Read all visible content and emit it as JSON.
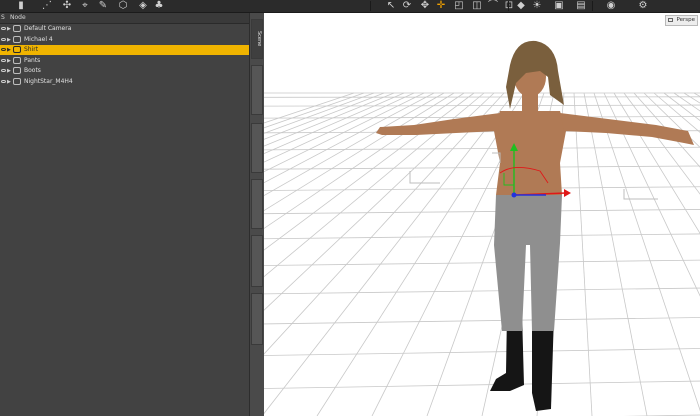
{
  "toolbar": {
    "icons": [
      "figure-icon",
      "wire-icon",
      "joint-icon",
      "node-icon",
      "brush-icon",
      "cube-icon",
      "geometry-icon",
      "morph-icon",
      "select-icon",
      "rotate-icon",
      "translate-icon",
      "universal-icon",
      "scale-icon",
      "edit-icon",
      "bone-icon",
      "node-tool-icon",
      "surface-icon",
      "light-icon",
      "camera-icon",
      "render-icon",
      "iray-icon",
      "settings-icon"
    ]
  },
  "scene": {
    "header": {
      "col1": "S",
      "col2": "Node"
    },
    "rows": [
      {
        "label": "Default Camera",
        "selected": false
      },
      {
        "label": "Michael 4",
        "selected": false
      },
      {
        "label": "Shirt",
        "selected": true
      },
      {
        "label": "Pants",
        "selected": false
      },
      {
        "label": "Boots",
        "selected": false
      },
      {
        "label": "NightStar_M4H4",
        "selected": false
      }
    ]
  },
  "tabs": [
    {
      "label": "Scene",
      "active": true
    },
    {
      "label": "",
      "active": false
    },
    {
      "label": "",
      "active": false
    },
    {
      "label": "",
      "active": false
    },
    {
      "label": "",
      "active": false
    },
    {
      "label": "",
      "active": false
    }
  ],
  "viewport": {
    "view_label": "Perspe",
    "colors": {
      "grid": "#c8c8c8",
      "skin": "#b07a55",
      "hair": "#7a5f3d",
      "pants": "#8f8f8f",
      "boots": "#151515",
      "gizmo_x": "#e01818",
      "gizmo_y": "#1fbf1f",
      "gizmo_z": "#2233dd"
    }
  },
  "colors": {
    "selection": "#f0b400",
    "panel": "#424242",
    "toolbar": "#2b2b2b"
  }
}
